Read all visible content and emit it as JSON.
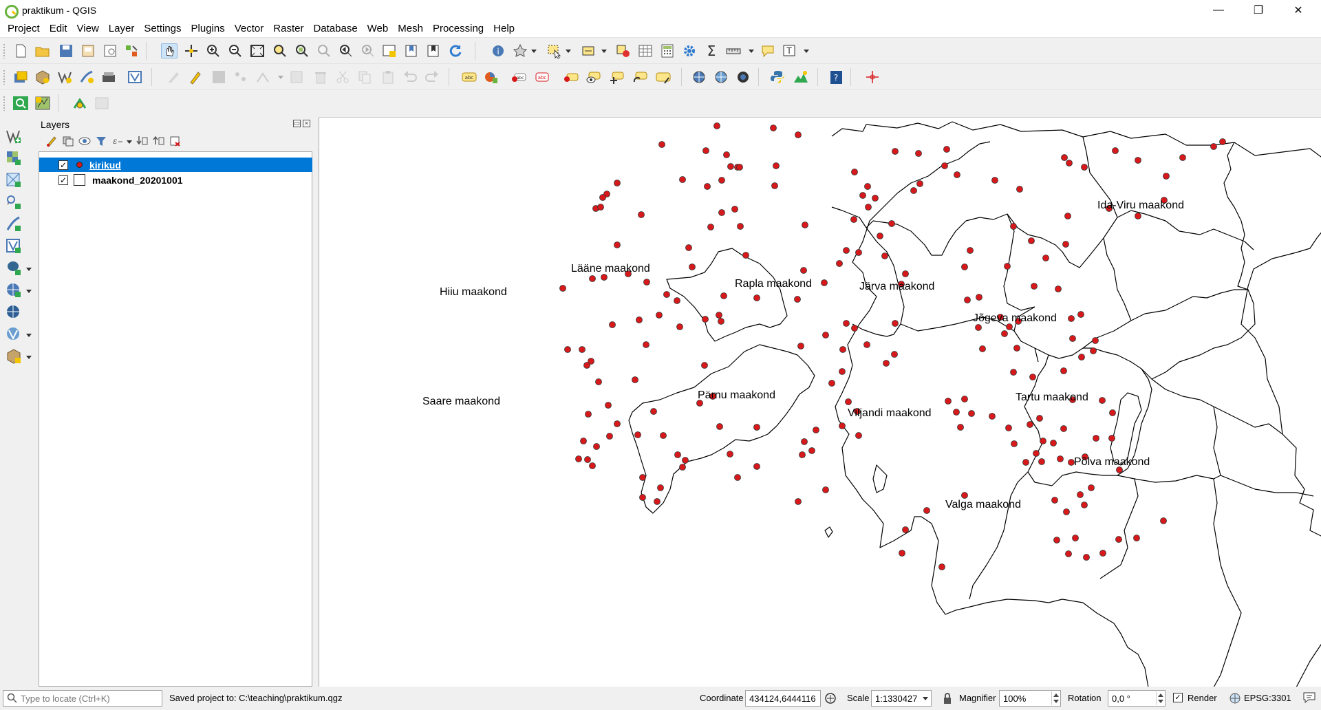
{
  "window": {
    "title": "praktikum - QGIS",
    "minimize_glyph": "—",
    "maximize_glyph": "❐",
    "close_glyph": "✕"
  },
  "menu": [
    "Project",
    "Edit",
    "View",
    "Layer",
    "Settings",
    "Plugins",
    "Vector",
    "Raster",
    "Database",
    "Web",
    "Mesh",
    "Processing",
    "Help"
  ],
  "layers_panel": {
    "title": "Layers",
    "layers": [
      {
        "name": "kirikud",
        "checked": true,
        "selected": true,
        "symbol": "point",
        "check_glyph": "✓"
      },
      {
        "name": "maakond_20201001",
        "checked": true,
        "selected": false,
        "symbol": "polygon",
        "check_glyph": "✓"
      }
    ]
  },
  "map": {
    "point_color": "#d7191c",
    "counties": [
      "Ida-Viru maakond",
      "Lääne maakond",
      "Rapla maakond",
      "Järva maakond",
      "Hiiu maakond",
      "Jõgeva maakond",
      "Saare maakond",
      "Pärnu maakond",
      "Tartu maakond",
      "Viljandi maakond",
      "Põlva maakond",
      "Valga maakond"
    ]
  },
  "status": {
    "locator_placeholder": "Type to locate (Ctrl+K)",
    "message": "Saved project to: C:\\teaching\\praktikum.qgz",
    "coordinate_label": "Coordinate",
    "coordinate_value": "434124,6444116",
    "scale_label": "Scale",
    "scale_value": "1:1330427",
    "magnifier_label": "Magnifier",
    "magnifier_value": "100%",
    "rotation_label": "Rotation",
    "rotation_value": "0,0 °",
    "render_label": "Render",
    "render_check": "✓",
    "crs": "EPSG:3301"
  }
}
